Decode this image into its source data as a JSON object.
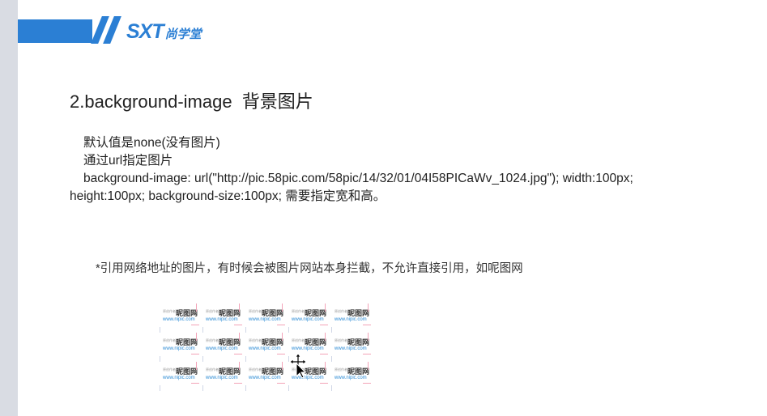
{
  "logo": {
    "en": "SXT",
    "cn": "尚学堂"
  },
  "slide": {
    "title": "2.background-image  背景图片",
    "lines": [
      "默认值是none(没有图片)",
      "通过url指定图片",
      "background-image: url(\"http://pic.58pic.com/58pic/14/32/01/04I58PICaWv_1024.jpg\"); width:100px;",
      "height:100px; background-size:100px;   需要指定宽和高。"
    ],
    "note": "*引用网络地址的图片，有时候会被图片网站本身拦截，不允许直接引用，如呢图网"
  },
  "watermark": {
    "tag": "原创作者：",
    "brand": "昵图网",
    "url": "www.nipic.com",
    "rows": 3,
    "cols": 5
  },
  "colors": {
    "brand_blue": "#2b7fd4",
    "text": "#222222",
    "link_blue": "#2a8ad4"
  },
  "icons": {
    "cursor": "move-cursor-icon"
  }
}
